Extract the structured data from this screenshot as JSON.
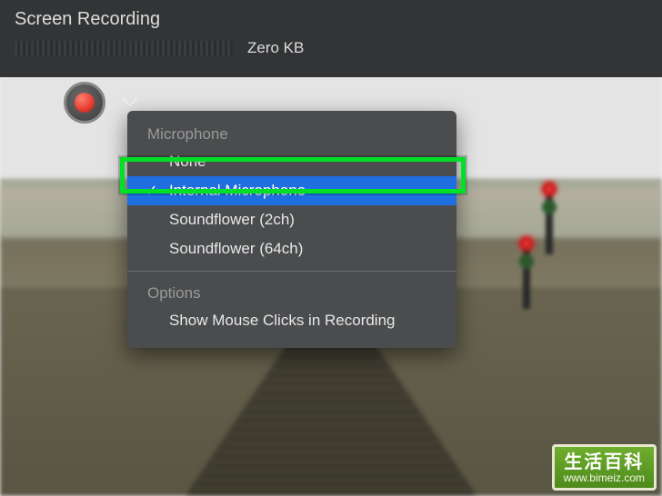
{
  "toolbar": {
    "title": "Screen Recording",
    "file_size": "Zero KB"
  },
  "dropdown": {
    "section_mic": "Microphone",
    "items_mic": [
      {
        "label": "None",
        "selected": false
      },
      {
        "label": "Internal Microphone",
        "selected": true
      },
      {
        "label": "Soundflower (2ch)",
        "selected": false
      },
      {
        "label": "Soundflower (64ch)",
        "selected": false
      }
    ],
    "section_options": "Options",
    "items_options": [
      {
        "label": "Show Mouse Clicks in Recording",
        "selected": false
      }
    ],
    "checkmark": "✓"
  },
  "watermark": {
    "line1": "生活百科",
    "line2": "www.bimeiz.com"
  }
}
